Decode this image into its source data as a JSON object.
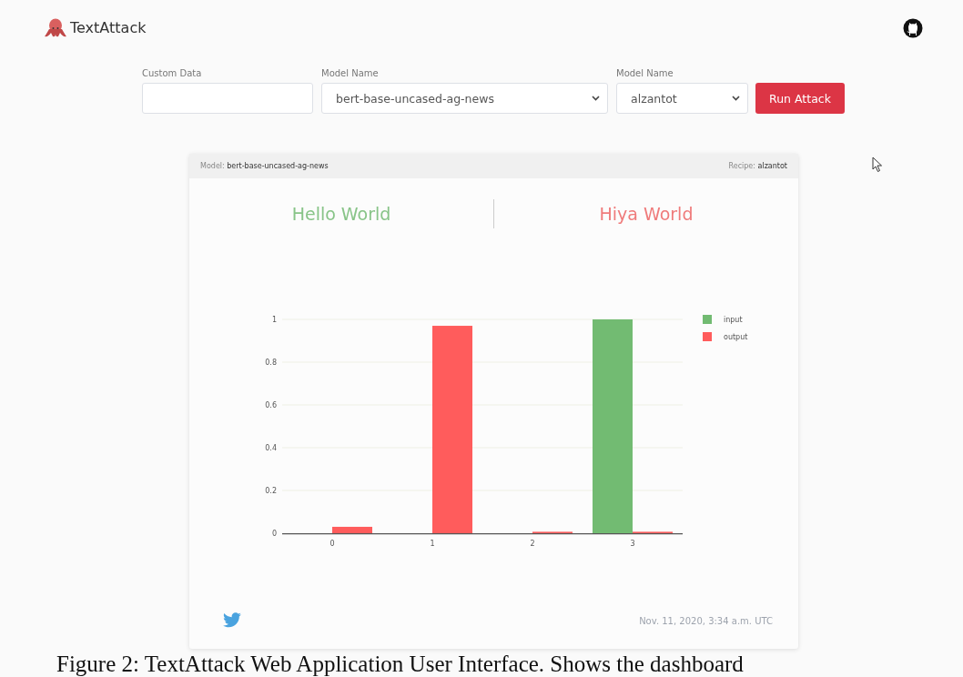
{
  "header": {
    "brand": "TextAttack"
  },
  "form": {
    "fields": [
      {
        "kind": "text",
        "label": "Custom Data"
      },
      {
        "kind": "select",
        "label": "Model Name",
        "value": "bert-base-uncased-ag-news"
      },
      {
        "kind": "select",
        "label": "Model Name",
        "value": "alzantot"
      }
    ],
    "button": "Run Attack"
  },
  "card": {
    "header": [
      {
        "label": "Model:",
        "value": "bert-base-uncased-ag-news"
      },
      {
        "label": "Recipe:",
        "value": "alzantot"
      }
    ],
    "titles": [
      {
        "text": "Hello World",
        "color": "#88c488"
      },
      {
        "text": "Hiya World",
        "color": "#ef7b7b"
      }
    ],
    "chart_data": {
      "type": "bar",
      "categories": [
        "0",
        "1",
        "2",
        "3"
      ],
      "series": [
        {
          "name": "input",
          "color": "#72bb72",
          "values": [
            0,
            0,
            0,
            1
          ]
        },
        {
          "name": "output",
          "color": "#ff5c5c",
          "values": [
            0.03,
            0.97,
            0.003,
            0.003
          ]
        }
      ],
      "ylim": [
        0,
        1
      ],
      "yticks": [
        0,
        0.2,
        0.4,
        0.6,
        0.8,
        1
      ],
      "grid": true,
      "legend": "right"
    },
    "timestamp": "Nov. 11, 2020, 3:34 a.m. UTC"
  },
  "caption": "Figure 2: TextAttack Web Application User Interface. Shows the dashboard"
}
